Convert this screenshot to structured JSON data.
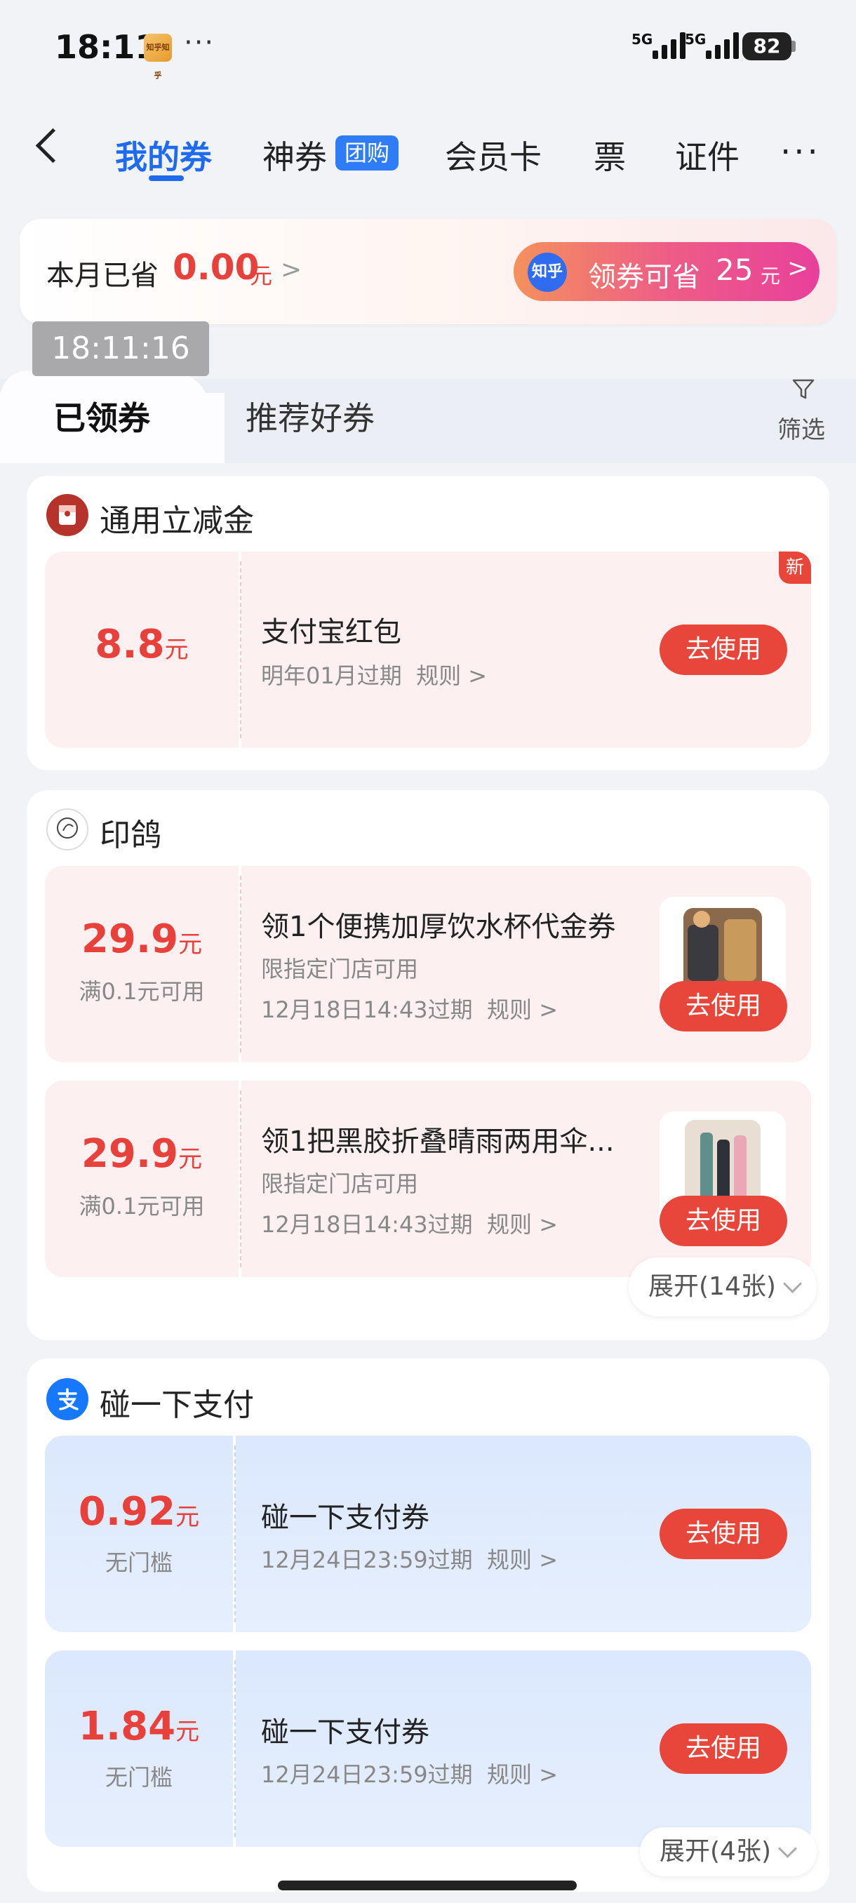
{
  "status_bar": {
    "time": "18:11",
    "app_icon_text": "知乎知乎",
    "more": "···",
    "signal1": "5G",
    "signal2": "5G",
    "battery": "82"
  },
  "header": {
    "tabs": [
      {
        "label": "我的券"
      },
      {
        "label": "神券"
      },
      {
        "label": "会员卡"
      },
      {
        "label": "票"
      },
      {
        "label": "证件"
      }
    ],
    "tuan_badge": "团购",
    "more": "···"
  },
  "banner": {
    "saved_label": "本月已省",
    "saved_amount": "0.00",
    "saved_unit": "元",
    "chevron": ">",
    "claim_icon": "知乎",
    "claim_text": "领券可省",
    "claim_amount": "25",
    "claim_unit": "元",
    "claim_chevron": ">"
  },
  "timestamp": "18:11:16",
  "subtabs": {
    "claimed": "已领券",
    "recommended": "推荐好券",
    "filter": "筛选"
  },
  "sections": [
    {
      "title": "通用立减金",
      "coupons": [
        {
          "amount": "8.8",
          "unit": "元",
          "condition": "",
          "title": "支付宝红包",
          "subtitle": "",
          "expiry": "明年01月过期",
          "rules": "规则 >",
          "button": "去使用",
          "badge": "新"
        }
      ]
    },
    {
      "title": "印鸽",
      "coupons": [
        {
          "amount": "29.9",
          "unit": "元",
          "condition": "满0.1元可用",
          "title": "领1个便携加厚饮水杯代金券",
          "subtitle": "限指定门店可用",
          "expiry": "12月18日14:43过期",
          "rules": "规则 >",
          "button": "去使用"
        },
        {
          "amount": "29.9",
          "unit": "元",
          "condition": "满0.1元可用",
          "title": "领1把黑胶折叠晴雨两用伞...",
          "subtitle": "限指定门店可用",
          "expiry": "12月18日14:43过期",
          "rules": "规则 >",
          "button": "去使用"
        }
      ],
      "expand": "展开(14张)"
    },
    {
      "title": "碰一下支付",
      "coupons": [
        {
          "amount": "0.92",
          "unit": "元",
          "condition": "无门槛",
          "title": "碰一下支付券",
          "expiry": "12月24日23:59过期",
          "rules": "规则 >",
          "button": "去使用"
        },
        {
          "amount": "1.84",
          "unit": "元",
          "condition": "无门槛",
          "title": "碰一下支付券",
          "expiry": "12月24日23:59过期",
          "rules": "规则 >",
          "button": "去使用"
        }
      ],
      "expand": "展开(4张)"
    }
  ],
  "colors": {
    "accent": "#1f6bf0",
    "price_red": "#e8403a",
    "button_red": "#e8463a"
  }
}
